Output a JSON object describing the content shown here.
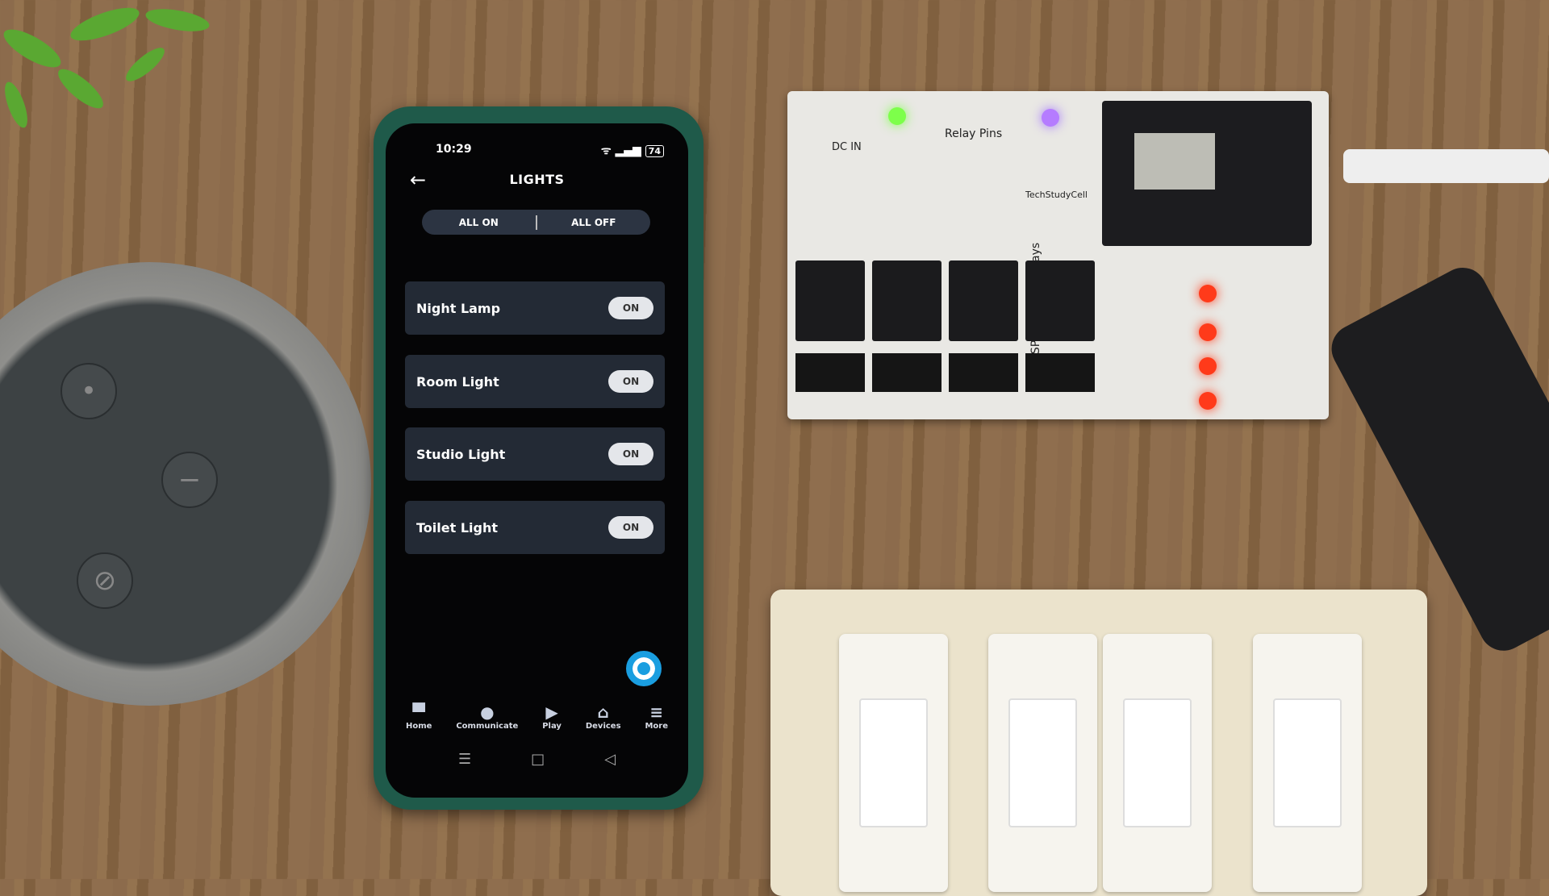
{
  "phone": {
    "status": {
      "time": "10:29",
      "battery": "74"
    },
    "header": {
      "title": "LIGHTS",
      "back_icon": "arrow-left-icon"
    },
    "segment": {
      "all_on": "ALL ON",
      "all_off": "ALL OFF"
    },
    "devices": [
      {
        "name": "Night Lamp",
        "state": "ON"
      },
      {
        "name": "Room Light",
        "state": "ON"
      },
      {
        "name": "Studio Light",
        "state": "ON"
      },
      {
        "name": "Toilet Light",
        "state": "ON"
      }
    ],
    "tabs": [
      {
        "label": "Home",
        "icon": "home-icon",
        "glyph": "▀"
      },
      {
        "label": "Communicate",
        "icon": "chat-icon",
        "glyph": "●"
      },
      {
        "label": "Play",
        "icon": "play-icon",
        "glyph": "▶"
      },
      {
        "label": "Devices",
        "icon": "devices-icon",
        "glyph": "⌂"
      },
      {
        "label": "More",
        "icon": "menu-icon",
        "glyph": "≡"
      }
    ],
    "nav": {
      "menu": "☰",
      "home": "□",
      "back": "◁"
    },
    "accent": "#1a9ee0"
  },
  "pcb": {
    "labels": [
      "DC IN",
      "Relay Pins",
      "TechStudyCell",
      "ESP32 control Relays"
    ]
  }
}
